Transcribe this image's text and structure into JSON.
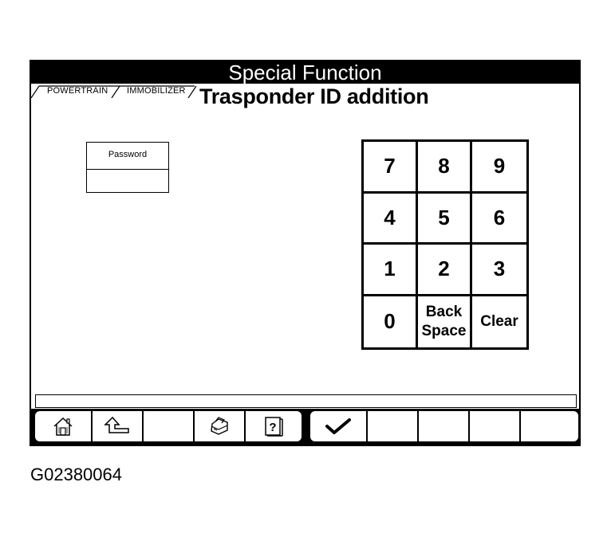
{
  "window": {
    "title": "Special Function"
  },
  "breadcrumb": {
    "items": [
      "POWERTRAIN",
      "IMMOBILIZER"
    ]
  },
  "page": {
    "title": "Trasponder ID addition"
  },
  "password": {
    "label": "Password",
    "value": ""
  },
  "keypad": {
    "keys": [
      {
        "label": "7"
      },
      {
        "label": "8"
      },
      {
        "label": "9"
      },
      {
        "label": "4"
      },
      {
        "label": "5"
      },
      {
        "label": "6"
      },
      {
        "label": "1"
      },
      {
        "label": "2"
      },
      {
        "label": "3"
      },
      {
        "label": "0"
      },
      {
        "line1": "Back",
        "line2": "Space"
      },
      {
        "label": "Clear"
      }
    ]
  },
  "status": {
    "text": ""
  },
  "toolbar": {
    "left_icons": [
      "home-icon",
      "back-arrow-icon",
      "blank",
      "print-icon",
      "help-icon"
    ],
    "right_icons": [
      "checkmark-icon",
      "blank",
      "blank",
      "blank",
      "blank"
    ]
  },
  "figure_id": "G02380064"
}
